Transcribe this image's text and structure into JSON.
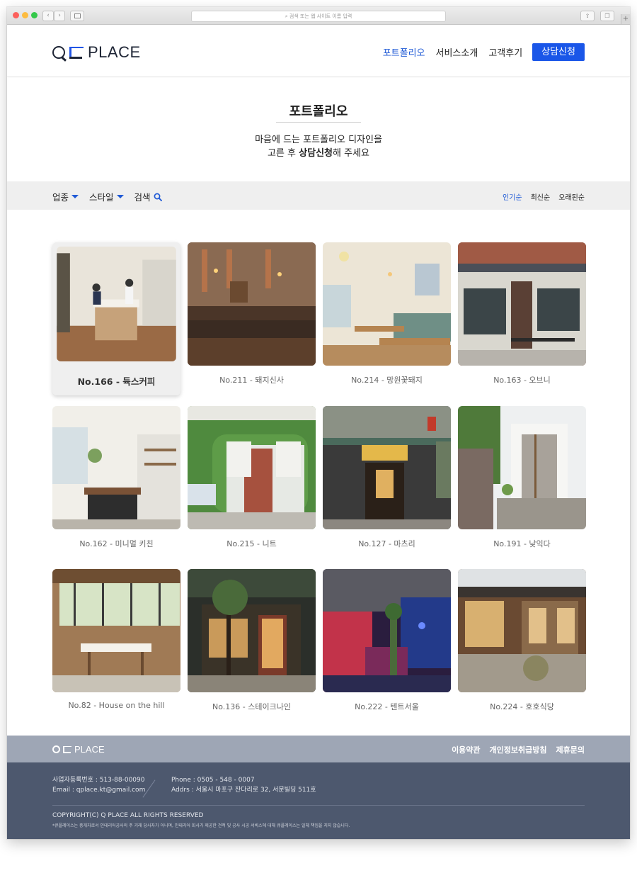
{
  "browser": {
    "url_placeholder": "검색 또는 웹 사이트 이름 입력"
  },
  "header": {
    "logo_text": "PLACE",
    "nav": [
      {
        "label": "포트폴리오",
        "active": true
      },
      {
        "label": "서비스소개",
        "active": false
      },
      {
        "label": "고객후기",
        "active": false
      }
    ],
    "cta_label": "상담신청"
  },
  "hero": {
    "title": "포트폴리오",
    "line1": "마음에 드는 포트폴리오 디자인을",
    "line2_pre": "고른 후 ",
    "line2_bold": "상담신청",
    "line2_post": "해 주세요"
  },
  "filters": {
    "industry": "업종",
    "style": "스타일",
    "search": "검색",
    "sort": [
      {
        "label": "인기순",
        "active": true
      },
      {
        "label": "최신순",
        "active": false
      },
      {
        "label": "오래된순",
        "active": false
      }
    ]
  },
  "portfolio": [
    {
      "caption": "No.166 - 듁스커피",
      "highlighted": true
    },
    {
      "caption": "No.211 - 돼지신사"
    },
    {
      "caption": "No.214 - 망원꽃돼지"
    },
    {
      "caption": "No.163 - 오브니"
    },
    {
      "caption": "No.162 - 미니멀 키친"
    },
    {
      "caption": "No.215 - 니트"
    },
    {
      "caption": "No.127 - 마츠리"
    },
    {
      "caption": "No.191 - 낮익다"
    },
    {
      "caption": "No.82 - House on the hill"
    },
    {
      "caption": "No.136 - 스테이크나인"
    },
    {
      "caption": "No.222 - 텐트서울"
    },
    {
      "caption": "No.224 - 호호식당"
    }
  ],
  "footer": {
    "logo_text": "PLACE",
    "links": [
      "이용약관",
      "개인정보취급방침",
      "제휴문의"
    ],
    "biz_no": "사업자등록번호 : 513-88-00090",
    "email": "Email : qplace.kt@gmail.com",
    "phone": "Phone : 0505 - 548 - 0007",
    "address": "Addrs : 서울시 마포구 잔다리로 32, 서문빌딩 511호",
    "copyright": "COPYRIGHT(C) Q PLACE ALL RIGHTS RESERVED",
    "notice": "*큐플레이스는 중개자로서 인테리어공사의 주 거래 당사자가 아니며, 인테리어 회사가 제공한 견적 및 공사 시공 서비스에 대해 큐플레이스는 일체 책임을 지지 않습니다."
  },
  "colors": {
    "accent": "#1a56e8",
    "footer_top": "#9ea6b5",
    "footer_bottom": "#4d586e"
  }
}
